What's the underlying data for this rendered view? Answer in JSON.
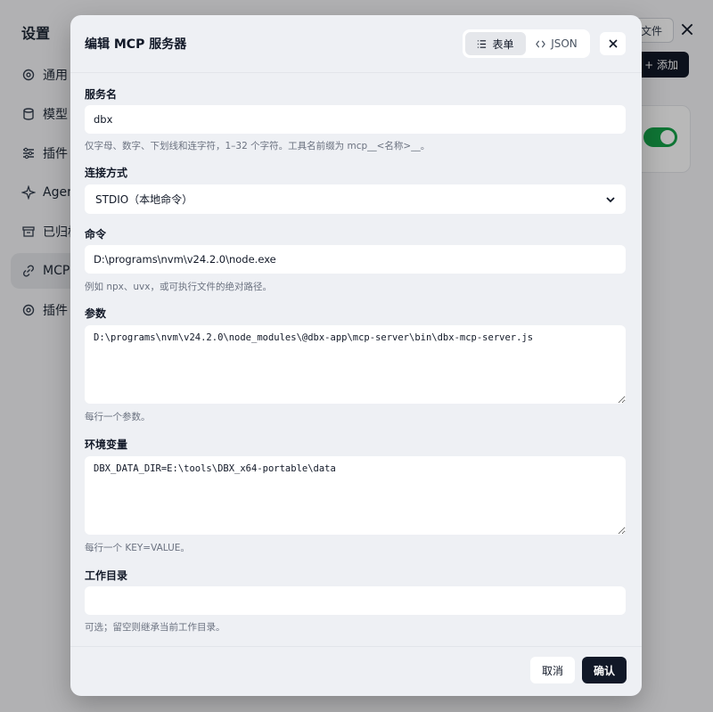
{
  "background": {
    "title": "设置",
    "nav_items": [
      "通用",
      "模型",
      "插件",
      "Agent",
      "已归档",
      "MCP",
      "插件"
    ],
    "file_button": "文件",
    "add_button": "+ 添加"
  },
  "modal": {
    "title": "编辑 MCP 服务器",
    "modes": {
      "form": "表单",
      "json": "JSON"
    },
    "fields": {
      "name": {
        "label": "服务名",
        "value": "dbx",
        "hint": "仅字母、数字、下划线和连字符，1–32 个字符。工具名前缀为 mcp__<名称>__。"
      },
      "transport": {
        "label": "连接方式",
        "value": "STDIO（本地命令）"
      },
      "command": {
        "label": "命令",
        "value": "D:\\programs\\nvm\\v24.2.0\\node.exe",
        "hint": "例如 npx、uvx，或可执行文件的绝对路径。"
      },
      "args": {
        "label": "参数",
        "value": "D:\\programs\\nvm\\v24.2.0\\node_modules\\@dbx-app\\mcp-server\\bin\\dbx-mcp-server.js",
        "hint": "每行一个参数。"
      },
      "env": {
        "label": "环境变量",
        "value": "DBX_DATA_DIR=E:\\tools\\DBX_x64-portable\\data",
        "hint": "每行一个 KEY=VALUE。"
      },
      "cwd": {
        "label": "工作目录",
        "value": "",
        "hint": "可选；留空则继承当前工作目录。"
      }
    },
    "buttons": {
      "cancel": "取消",
      "confirm": "确认"
    }
  }
}
